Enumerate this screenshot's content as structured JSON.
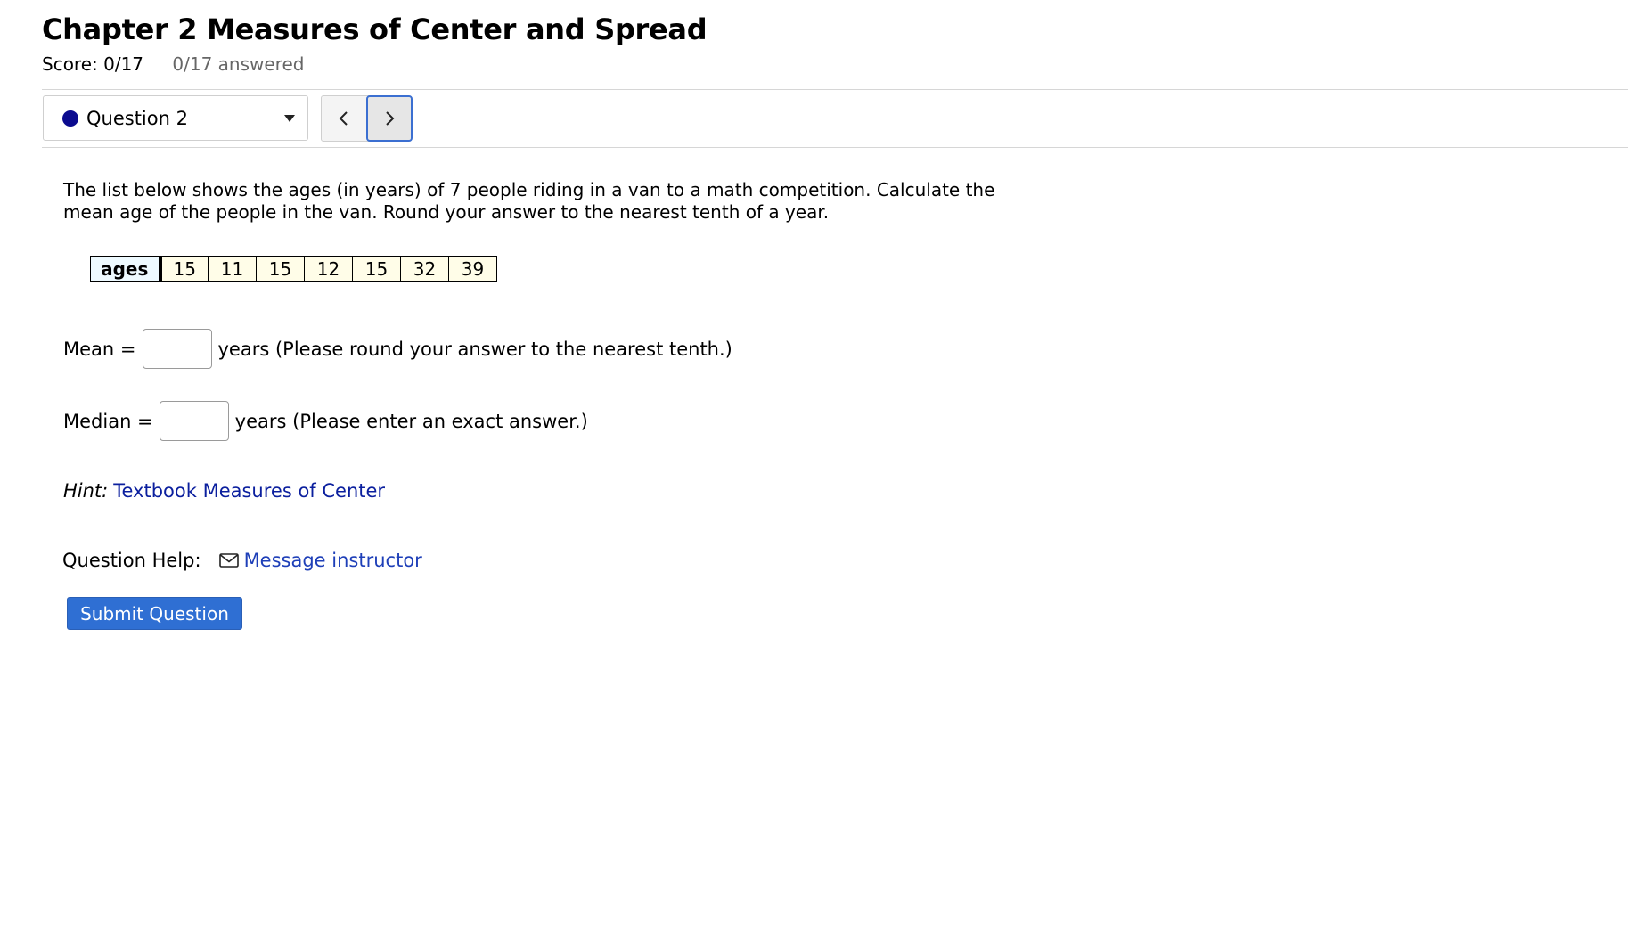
{
  "header": {
    "title": "Chapter 2 Measures of Center and Spread",
    "score": "Score: 0/17",
    "answered": "0/17 answered"
  },
  "question_nav": {
    "selected": "Question 2",
    "status_color": "#0b0b8f"
  },
  "question": {
    "text": "The list below shows the ages (in years) of 7 people riding in a van to a math competition. Calculate the mean age of the people in the van. Round your answer to the nearest tenth of a year.",
    "table": {
      "header": "ages",
      "values": [
        "15",
        "11",
        "15",
        "12",
        "15",
        "32",
        "39"
      ]
    },
    "mean": {
      "label": "Mean =",
      "value": "",
      "suffix": "years (Please round your answer to the nearest tenth.)"
    },
    "median": {
      "label": "Median =",
      "value": "",
      "suffix": "years (Please enter an exact answer.)"
    },
    "hint": {
      "label": "Hint:",
      "link": "Textbook Measures of Center"
    }
  },
  "help": {
    "label": "Question Help:",
    "link": "Message instructor",
    "icon": "mail-icon"
  },
  "submit": {
    "label": "Submit Question",
    "color": "#2f6fd3"
  }
}
